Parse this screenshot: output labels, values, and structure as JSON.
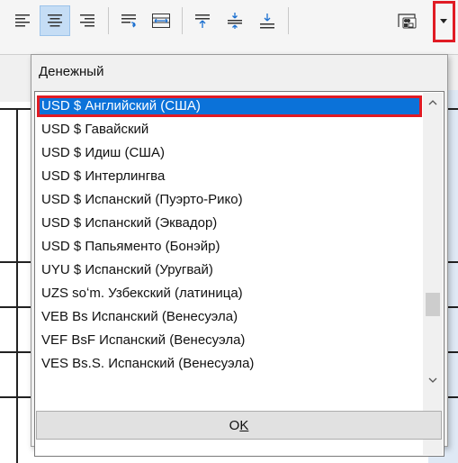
{
  "toolbar": {
    "buttons": [
      {
        "name": "align-left-icon"
      },
      {
        "name": "align-center-icon",
        "active": true
      },
      {
        "name": "align-right-icon"
      },
      {
        "name": "wrap-text-icon"
      },
      {
        "name": "merge-cells-icon"
      },
      {
        "name": "align-top-icon"
      },
      {
        "name": "align-middle-icon"
      },
      {
        "name": "align-bottom-icon"
      },
      {
        "name": "currency-format-icon"
      },
      {
        "name": "dropdown-arrow-icon",
        "highlighted": true
      }
    ]
  },
  "popup": {
    "label": "Денежный",
    "label_accesskey": "Д",
    "label_rest": "енежный",
    "items": [
      {
        "text": "USD $ Английский (США)",
        "selected": true
      },
      {
        "text": "USD $ Гавайский"
      },
      {
        "text": "USD $ Идиш (США)"
      },
      {
        "text": "USD $ Интерлингва"
      },
      {
        "text": "USD $ Испанский (Пуэрто-Рико)"
      },
      {
        "text": "USD $ Испанский (Эквадор)"
      },
      {
        "text": "USD $ Папьяменто (Бонэйр)"
      },
      {
        "text": "UYU $ Испанский (Уругвай)"
      },
      {
        "text": "UZS soʻm. Узбекский (латиница)"
      },
      {
        "text": "VEB Bs Испанский (Венесуэла)"
      },
      {
        "text": "VEF BsF Испанский (Венесуэла)"
      },
      {
        "text": "VES Bs.S. Испанский (Венесуэла)"
      }
    ],
    "ok_button": "OK",
    "ok_first": "O",
    "ok_underlined": "K"
  },
  "colors": {
    "selection": "#0b72d9",
    "highlight_border": "#e01b24",
    "active_button": "#c5ddf5"
  }
}
